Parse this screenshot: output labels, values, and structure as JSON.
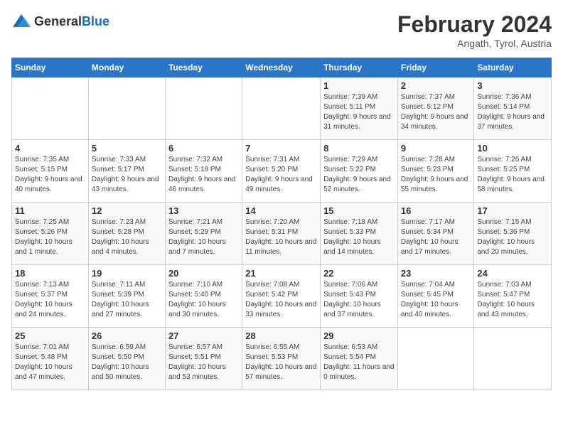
{
  "logo": {
    "general": "General",
    "blue": "Blue"
  },
  "title": "February 2024",
  "subtitle": "Angath, Tyrol, Austria",
  "days_of_week": [
    "Sunday",
    "Monday",
    "Tuesday",
    "Wednesday",
    "Thursday",
    "Friday",
    "Saturday"
  ],
  "weeks": [
    [
      {
        "day": "",
        "sunrise": "",
        "sunset": "",
        "daylight": ""
      },
      {
        "day": "",
        "sunrise": "",
        "sunset": "",
        "daylight": ""
      },
      {
        "day": "",
        "sunrise": "",
        "sunset": "",
        "daylight": ""
      },
      {
        "day": "",
        "sunrise": "",
        "sunset": "",
        "daylight": ""
      },
      {
        "day": "1",
        "sunrise": "Sunrise: 7:39 AM",
        "sunset": "Sunset: 5:11 PM",
        "daylight": "Daylight: 9 hours and 31 minutes."
      },
      {
        "day": "2",
        "sunrise": "Sunrise: 7:37 AM",
        "sunset": "Sunset: 5:12 PM",
        "daylight": "Daylight: 9 hours and 34 minutes."
      },
      {
        "day": "3",
        "sunrise": "Sunrise: 7:36 AM",
        "sunset": "Sunset: 5:14 PM",
        "daylight": "Daylight: 9 hours and 37 minutes."
      }
    ],
    [
      {
        "day": "4",
        "sunrise": "Sunrise: 7:35 AM",
        "sunset": "Sunset: 5:15 PM",
        "daylight": "Daylight: 9 hours and 40 minutes."
      },
      {
        "day": "5",
        "sunrise": "Sunrise: 7:33 AM",
        "sunset": "Sunset: 5:17 PM",
        "daylight": "Daylight: 9 hours and 43 minutes."
      },
      {
        "day": "6",
        "sunrise": "Sunrise: 7:32 AM",
        "sunset": "Sunset: 5:18 PM",
        "daylight": "Daylight: 9 hours and 46 minutes."
      },
      {
        "day": "7",
        "sunrise": "Sunrise: 7:31 AM",
        "sunset": "Sunset: 5:20 PM",
        "daylight": "Daylight: 9 hours and 49 minutes."
      },
      {
        "day": "8",
        "sunrise": "Sunrise: 7:29 AM",
        "sunset": "Sunset: 5:22 PM",
        "daylight": "Daylight: 9 hours and 52 minutes."
      },
      {
        "day": "9",
        "sunrise": "Sunrise: 7:28 AM",
        "sunset": "Sunset: 5:23 PM",
        "daylight": "Daylight: 9 hours and 55 minutes."
      },
      {
        "day": "10",
        "sunrise": "Sunrise: 7:26 AM",
        "sunset": "Sunset: 5:25 PM",
        "daylight": "Daylight: 9 hours and 58 minutes."
      }
    ],
    [
      {
        "day": "11",
        "sunrise": "Sunrise: 7:25 AM",
        "sunset": "Sunset: 5:26 PM",
        "daylight": "Daylight: 10 hours and 1 minute."
      },
      {
        "day": "12",
        "sunrise": "Sunrise: 7:23 AM",
        "sunset": "Sunset: 5:28 PM",
        "daylight": "Daylight: 10 hours and 4 minutes."
      },
      {
        "day": "13",
        "sunrise": "Sunrise: 7:21 AM",
        "sunset": "Sunset: 5:29 PM",
        "daylight": "Daylight: 10 hours and 7 minutes."
      },
      {
        "day": "14",
        "sunrise": "Sunrise: 7:20 AM",
        "sunset": "Sunset: 5:31 PM",
        "daylight": "Daylight: 10 hours and 11 minutes."
      },
      {
        "day": "15",
        "sunrise": "Sunrise: 7:18 AM",
        "sunset": "Sunset: 5:33 PM",
        "daylight": "Daylight: 10 hours and 14 minutes."
      },
      {
        "day": "16",
        "sunrise": "Sunrise: 7:17 AM",
        "sunset": "Sunset: 5:34 PM",
        "daylight": "Daylight: 10 hours and 17 minutes."
      },
      {
        "day": "17",
        "sunrise": "Sunrise: 7:15 AM",
        "sunset": "Sunset: 5:36 PM",
        "daylight": "Daylight: 10 hours and 20 minutes."
      }
    ],
    [
      {
        "day": "18",
        "sunrise": "Sunrise: 7:13 AM",
        "sunset": "Sunset: 5:37 PM",
        "daylight": "Daylight: 10 hours and 24 minutes."
      },
      {
        "day": "19",
        "sunrise": "Sunrise: 7:11 AM",
        "sunset": "Sunset: 5:39 PM",
        "daylight": "Daylight: 10 hours and 27 minutes."
      },
      {
        "day": "20",
        "sunrise": "Sunrise: 7:10 AM",
        "sunset": "Sunset: 5:40 PM",
        "daylight": "Daylight: 10 hours and 30 minutes."
      },
      {
        "day": "21",
        "sunrise": "Sunrise: 7:08 AM",
        "sunset": "Sunset: 5:42 PM",
        "daylight": "Daylight: 10 hours and 33 minutes."
      },
      {
        "day": "22",
        "sunrise": "Sunrise: 7:06 AM",
        "sunset": "Sunset: 5:43 PM",
        "daylight": "Daylight: 10 hours and 37 minutes."
      },
      {
        "day": "23",
        "sunrise": "Sunrise: 7:04 AM",
        "sunset": "Sunset: 5:45 PM",
        "daylight": "Daylight: 10 hours and 40 minutes."
      },
      {
        "day": "24",
        "sunrise": "Sunrise: 7:03 AM",
        "sunset": "Sunset: 5:47 PM",
        "daylight": "Daylight: 10 hours and 43 minutes."
      }
    ],
    [
      {
        "day": "25",
        "sunrise": "Sunrise: 7:01 AM",
        "sunset": "Sunset: 5:48 PM",
        "daylight": "Daylight: 10 hours and 47 minutes."
      },
      {
        "day": "26",
        "sunrise": "Sunrise: 6:59 AM",
        "sunset": "Sunset: 5:50 PM",
        "daylight": "Daylight: 10 hours and 50 minutes."
      },
      {
        "day": "27",
        "sunrise": "Sunrise: 6:57 AM",
        "sunset": "Sunset: 5:51 PM",
        "daylight": "Daylight: 10 hours and 53 minutes."
      },
      {
        "day": "28",
        "sunrise": "Sunrise: 6:55 AM",
        "sunset": "Sunset: 5:53 PM",
        "daylight": "Daylight: 10 hours and 57 minutes."
      },
      {
        "day": "29",
        "sunrise": "Sunrise: 6:53 AM",
        "sunset": "Sunset: 5:54 PM",
        "daylight": "Daylight: 11 hours and 0 minutes."
      },
      {
        "day": "",
        "sunrise": "",
        "sunset": "",
        "daylight": ""
      },
      {
        "day": "",
        "sunrise": "",
        "sunset": "",
        "daylight": ""
      }
    ]
  ]
}
